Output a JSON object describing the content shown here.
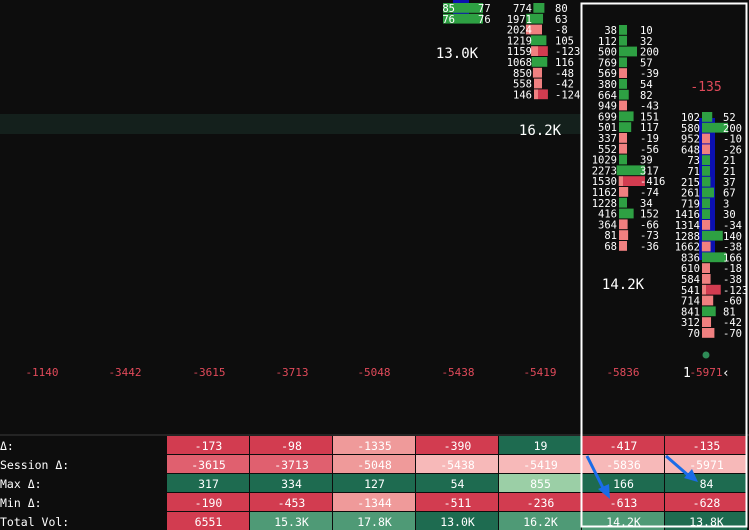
{
  "colors": {
    "background": "#0d0d0d",
    "band": "#14201c",
    "text": "#ffffff",
    "delta_text": "#e04a5a",
    "bid": "#2ea043",
    "ask": "#f08080",
    "ask_strong": "#d23c50",
    "poc": "#0b10b0",
    "cell_green": "#1e6b50",
    "cell_green_light": "#4f9a76",
    "cell_green_pale": "#9bcfa6",
    "cell_red": "#d23c50",
    "cell_red_mid": "#e0606f",
    "cell_red_light": "#ef9a9a",
    "cell_red_pale": "#f7b9b9",
    "selection": "#ffffff",
    "arrow": "#1a6ce8"
  },
  "chart_data": {
    "type": "table",
    "columns_upper_partial": {
      "col6": {
        "rows": [
          {
            "bid": "85",
            "ask": "77"
          },
          {
            "bid": "76",
            "ask": "76"
          }
        ]
      },
      "col7": {
        "rows": [
          {
            "bid": "774",
            "ask": "80"
          },
          {
            "bid": "1971",
            "ask": "63"
          },
          {
            "bid": "2024",
            "ask": "-8"
          },
          {
            "bid": "1219",
            "ask": "105"
          },
          {
            "bid": "1159",
            "ask": "-123"
          },
          {
            "bid": "1068",
            "ask": "116"
          },
          {
            "bid": "850",
            "ask": "-48"
          },
          {
            "bid": "558",
            "ask": "-42"
          },
          {
            "bid": "146",
            "ask": "-124"
          }
        ]
      }
    },
    "column8": {
      "rows": [
        {
          "bid": "38",
          "ask": "10"
        },
        {
          "bid": "112",
          "ask": "32"
        },
        {
          "bid": "500",
          "ask": "200"
        },
        {
          "bid": "769",
          "ask": "57"
        },
        {
          "bid": "569",
          "ask": "-39"
        },
        {
          "bid": "380",
          "ask": "54"
        },
        {
          "bid": "664",
          "ask": "82"
        },
        {
          "bid": "949",
          "ask": "-43"
        },
        {
          "bid": "699",
          "ask": "151"
        },
        {
          "bid": "501",
          "ask": "117"
        },
        {
          "bid": "337",
          "ask": "-19"
        },
        {
          "bid": "552",
          "ask": "-56"
        },
        {
          "bid": "1029",
          "ask": "39"
        },
        {
          "bid": "2273",
          "ask": "317"
        },
        {
          "bid": "1530",
          "ask": "-416"
        },
        {
          "bid": "1162",
          "ask": "-74"
        },
        {
          "bid": "1228",
          "ask": "34"
        },
        {
          "bid": "416",
          "ask": "152"
        },
        {
          "bid": "364",
          "ask": "-66"
        },
        {
          "bid": "81",
          "ask": "-73"
        },
        {
          "bid": "68",
          "ask": "-36"
        }
      ]
    },
    "column9": {
      "rows": [
        {
          "bid": "102",
          "ask": "52"
        },
        {
          "bid": "580",
          "ask": "200"
        },
        {
          "bid": "952",
          "ask": "-10"
        },
        {
          "bid": "648",
          "ask": "-26"
        },
        {
          "bid": "73",
          "ask": "21"
        },
        {
          "bid": "71",
          "ask": "21"
        },
        {
          "bid": "215",
          "ask": "37"
        },
        {
          "bid": "261",
          "ask": "67"
        },
        {
          "bid": "719",
          "ask": "3"
        },
        {
          "bid": "1416",
          "ask": "30"
        },
        {
          "bid": "1314",
          "ask": "-34"
        },
        {
          "bid": "1288",
          "ask": "140"
        },
        {
          "bid": "1662",
          "ask": "-38"
        },
        {
          "bid": "836",
          "ask": "166"
        },
        {
          "bid": "610",
          "ask": "-18"
        },
        {
          "bid": "584",
          "ask": "-38"
        },
        {
          "bid": "541",
          "ask": "-123"
        },
        {
          "bid": "714",
          "ask": "-60"
        },
        {
          "bid": "841",
          "ask": "81"
        },
        {
          "bid": "312",
          "ask": "-42"
        },
        {
          "bid": "70",
          "ask": "-70"
        }
      ]
    },
    "volume_labels": [
      {
        "text": "13.0K"
      },
      {
        "text": "16.2K"
      },
      {
        "text": "14.2K"
      }
    ],
    "delta_top_label": "-135",
    "cumulative_delta_row": [
      "-1140",
      "-3442",
      "-3615",
      "-3713",
      "-5048",
      "-5438",
      "-5419",
      "-5836",
      "-5971"
    ],
    "cursor_glyph": "1",
    "cursor_tail": "‹",
    "summary_table": {
      "row_labels": [
        "Δ:",
        "Session Δ:",
        "Max Δ:",
        "Min Δ:",
        "Total Vol:"
      ],
      "columns": [
        {
          "delta": "-173",
          "session": "-3615",
          "max": "317",
          "min": "-190",
          "vol": "6551"
        },
        {
          "delta": "-98",
          "session": "-3713",
          "max": "334",
          "min": "-453",
          "vol": "15.3K"
        },
        {
          "delta": "-1335",
          "session": "-5048",
          "max": "127",
          "min": "-1344",
          "vol": "17.8K"
        },
        {
          "delta": "-390",
          "session": "-5438",
          "max": "54",
          "min": "-511",
          "vol": "13.0K"
        },
        {
          "delta": "19",
          "session": "-5419",
          "max": "855",
          "min": "-236",
          "vol": "16.2K"
        },
        {
          "delta": "-417",
          "session": "-5836",
          "max": "166",
          "min": "-613",
          "vol": "14.2K"
        },
        {
          "delta": "-135",
          "session": "-5971",
          "max": "84",
          "min": "-628",
          "vol": "13.8K"
        }
      ]
    }
  }
}
